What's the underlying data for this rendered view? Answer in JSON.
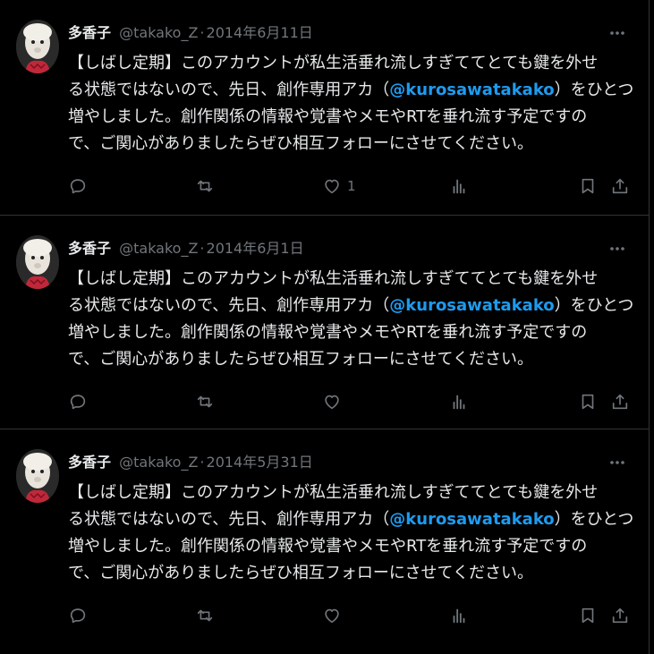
{
  "tweets": [
    {
      "display_name": "多香子",
      "handle": "@takako_Z",
      "dot": "·",
      "date": "2014年6月11日",
      "lines": [
        "【しばし定期】このアカウントが私生活垂れ流しすぎててとても鍵を外せ",
        "る状態ではないので、先日、創作専用アカ（",
        "@kurosawatakako",
        "）をひとつ",
        "増やしました。創作関係の情報や覚書やメモやRTを垂れ流す予定ですの",
        "で、ご関心がありましたらぜひ相互フォローにさせてください。"
      ],
      "like_count": "1"
    },
    {
      "display_name": "多香子",
      "handle": "@takako_Z",
      "dot": "·",
      "date": "2014年6月1日",
      "lines": [
        "【しばし定期】このアカウントが私生活垂れ流しすぎててとても鍵を外せ",
        "る状態ではないので、先日、創作専用アカ（",
        "@kurosawatakako",
        "）をひとつ",
        "増やしました。創作関係の情報や覚書やメモやRTを垂れ流す予定ですの",
        "で、ご関心がありましたらぜひ相互フォローにさせてください。"
      ],
      "like_count": ""
    },
    {
      "display_name": "多香子",
      "handle": "@takako_Z",
      "dot": "·",
      "date": "2014年5月31日",
      "lines": [
        "【しばし定期】このアカウントが私生活垂れ流しすぎててとても鍵を外せ",
        "る状態ではないので、先日、創作専用アカ（",
        "@kurosawatakako",
        "）をひとつ",
        "増やしました。創作関係の情報や覚書やメモやRTを垂れ流す予定ですの",
        "で、ご関心がありましたらぜひ相互フォローにさせてください。"
      ],
      "like_count": ""
    }
  ],
  "icons": {
    "avatar": "alpaca-avatar",
    "more": "more-horizontal-icon",
    "reply": "reply-icon",
    "retweet": "retweet-icon",
    "like": "heart-icon",
    "views": "views-chart-icon",
    "bookmark": "bookmark-icon",
    "share": "share-icon"
  },
  "colors": {
    "background": "#000000",
    "text": "#e7e9ea",
    "muted": "#71767b",
    "accent": "#1d9bf0",
    "divider": "#2f3336"
  }
}
